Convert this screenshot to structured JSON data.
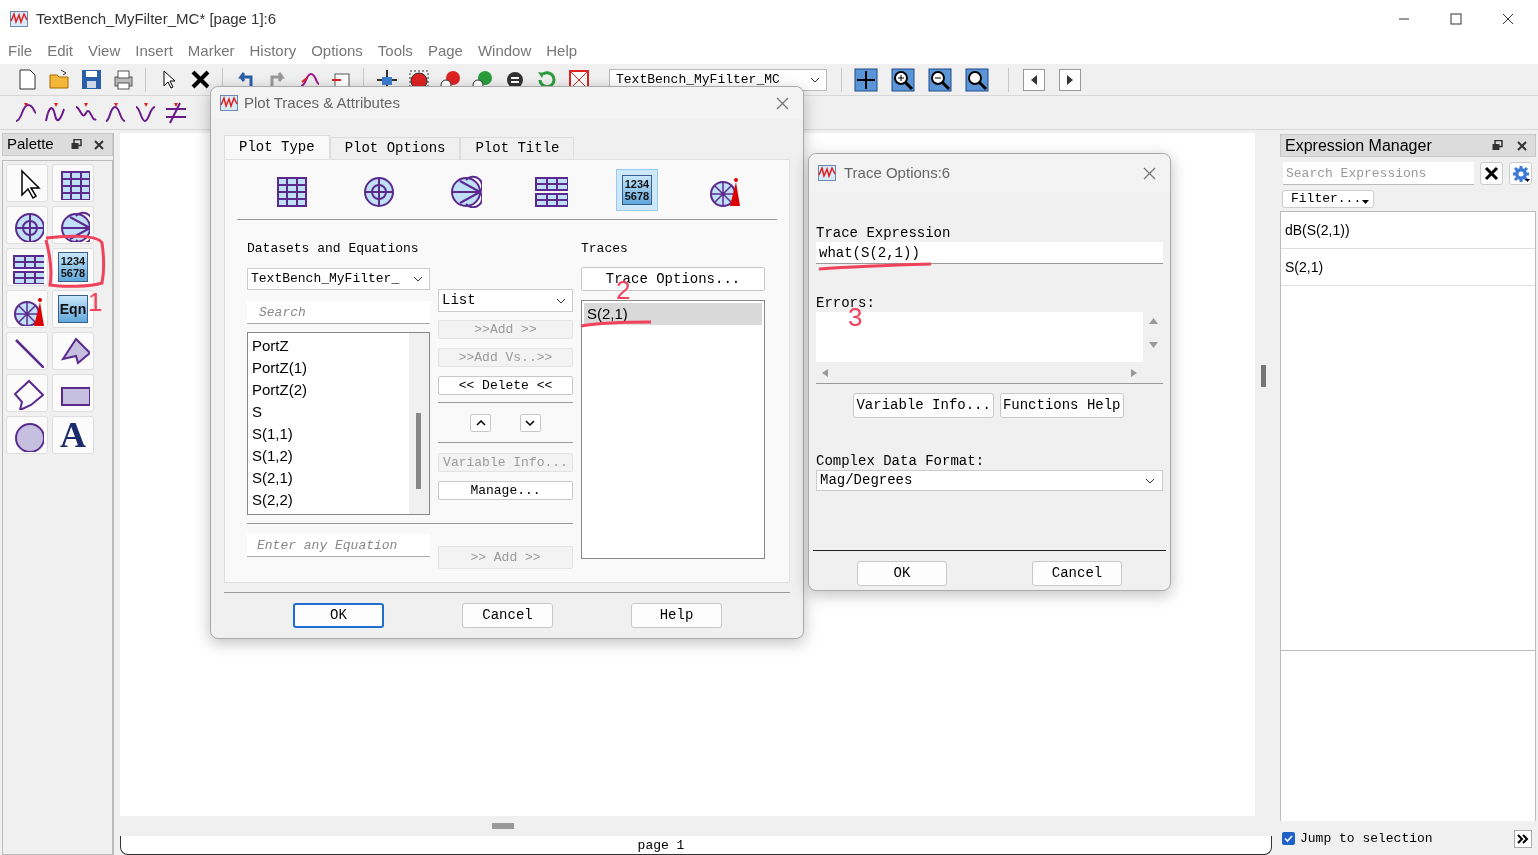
{
  "window": {
    "title": "TextBench_MyFilter_MC* [page 1]:6"
  },
  "menu": [
    {
      "label": "File"
    },
    {
      "label": "Edit"
    },
    {
      "label": "View"
    },
    {
      "label": "Insert"
    },
    {
      "label": "Marker"
    },
    {
      "label": "History"
    },
    {
      "label": "Options"
    },
    {
      "label": "Tools"
    },
    {
      "label": "Page"
    },
    {
      "label": "Window"
    },
    {
      "label": "Help"
    }
  ],
  "toolbar": {
    "design_dropdown": "TextBench_MyFilter_MC"
  },
  "palette": {
    "title": "Palette",
    "tools": [
      {
        "kind": "pointer"
      },
      {
        "kind": "grid"
      },
      {
        "kind": "polar"
      },
      {
        "kind": "smith"
      },
      {
        "kind": "table"
      },
      {
        "kind": "numbers",
        "lines": [
          "1234",
          "5678"
        ]
      },
      {
        "kind": "antenna"
      },
      {
        "kind": "equation",
        "label": "Eqn"
      },
      {
        "kind": "line"
      },
      {
        "kind": "polygon"
      },
      {
        "kind": "polyline"
      },
      {
        "kind": "rectangle"
      },
      {
        "kind": "ellipse"
      },
      {
        "kind": "text",
        "label": "A"
      }
    ]
  },
  "plot_traces_dialog": {
    "title": "Plot Traces & Attributes",
    "tabs": [
      {
        "label": "Plot Type",
        "selected": true
      },
      {
        "label": "Plot Options",
        "selected": false
      },
      {
        "label": "Plot Title",
        "selected": false
      }
    ],
    "plot_types": [
      {
        "kind": "grid",
        "selected": false
      },
      {
        "kind": "polar",
        "selected": false
      },
      {
        "kind": "smith",
        "selected": false
      },
      {
        "kind": "table",
        "selected": false
      },
      {
        "kind": "numbers",
        "lines": [
          "1234",
          "5678"
        ],
        "selected": true
      },
      {
        "kind": "antenna",
        "selected": false
      }
    ],
    "datasets_label": "Datasets and Equations",
    "dataset": "TextBench_MyFilter_",
    "search_placeholder": "Search",
    "list_mode": "List",
    "variables": [
      "PortZ",
      "PortZ(1)",
      "PortZ(2)",
      "S",
      "S(1,1)",
      "S(1,2)",
      "S(2,1)",
      "S(2,2)"
    ],
    "add_button": {
      "label": ">>Add >>",
      "disabled": true
    },
    "add_vs_button": {
      "label": ">>Add Vs..>>",
      "disabled": true
    },
    "delete_button": {
      "label": "<< Delete <<",
      "disabled": false
    },
    "variable_info_button": {
      "label": "Variable Info...",
      "disabled": true
    },
    "manage_button": {
      "label": "Manage...",
      "disabled": false
    },
    "equation_placeholder": "Enter any Equation",
    "add_equation_button": {
      "label": ">> Add >>",
      "disabled": true
    },
    "traces_label": "Traces",
    "trace_options_button": "Trace Options...",
    "traces": [
      {
        "label": "S(2,1)",
        "selected": true
      }
    ],
    "buttons": [
      {
        "label": "OK",
        "default": true
      },
      {
        "label": "Cancel",
        "default": false
      },
      {
        "label": "Help",
        "default": false
      }
    ]
  },
  "trace_options_dialog": {
    "title": "Trace Options:6",
    "expression_label": "Trace Expression",
    "expression": "what(S(2,1))",
    "errors_label": "Errors:",
    "variable_info_button": "Variable Info...",
    "functions_help_button": "Functions Help",
    "format_label": "Complex Data Format:",
    "format": "Mag/Degrees",
    "buttons": [
      "OK",
      "Cancel"
    ]
  },
  "expression_manager": {
    "title": "Expression Manager",
    "search_placeholder": "Search Expressions",
    "filter": "Filter...",
    "items": [
      "dB(S(2,1))",
      "S(2,1)"
    ],
    "jump_to_selection": {
      "label": "Jump to selection",
      "checked": true
    }
  },
  "page_tab": "page 1",
  "annotations": [
    {
      "text": "1"
    },
    {
      "text": "2"
    },
    {
      "text": "3"
    }
  ]
}
